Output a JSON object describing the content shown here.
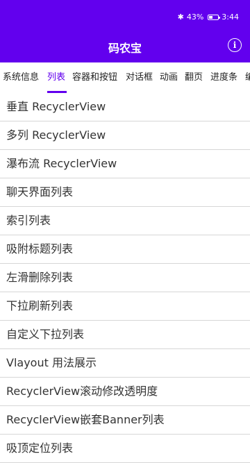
{
  "status": {
    "battery_percent": "43%",
    "battery_level": 0.43,
    "time": "3:44",
    "bluetooth_icon": "bluetooth-icon",
    "battery_icon": "battery-charging-icon"
  },
  "appbar": {
    "title": "码农宝",
    "info_icon": "info-icon",
    "info_glyph": "i",
    "background": "#6200ee"
  },
  "tabs": [
    {
      "label": "系统信息",
      "active": false
    },
    {
      "label": "列表",
      "active": true
    },
    {
      "label": "容器和按钮",
      "active": false
    },
    {
      "label": "对话框",
      "active": false
    },
    {
      "label": "动画",
      "active": false
    },
    {
      "label": "翻页",
      "active": false
    },
    {
      "label": "进度条",
      "active": false
    },
    {
      "label": "编",
      "active": false
    }
  ],
  "list": {
    "items": [
      "垂直 RecyclerView",
      "多列 RecyclerView",
      "瀑布流 RecyclerView",
      "聊天界面列表",
      "索引列表",
      "吸附标题列表",
      "左滑删除列表",
      "下拉刷新列表",
      "自定义下拉列表",
      "Vlayout 用法展示",
      "RecyclerView滚动修改透明度",
      "RecyclerView嵌套Banner列表",
      "吸顶定位列表"
    ]
  },
  "colors": {
    "accent": "#6200ee",
    "text": "#333333",
    "divider": "#d6d6d6"
  }
}
